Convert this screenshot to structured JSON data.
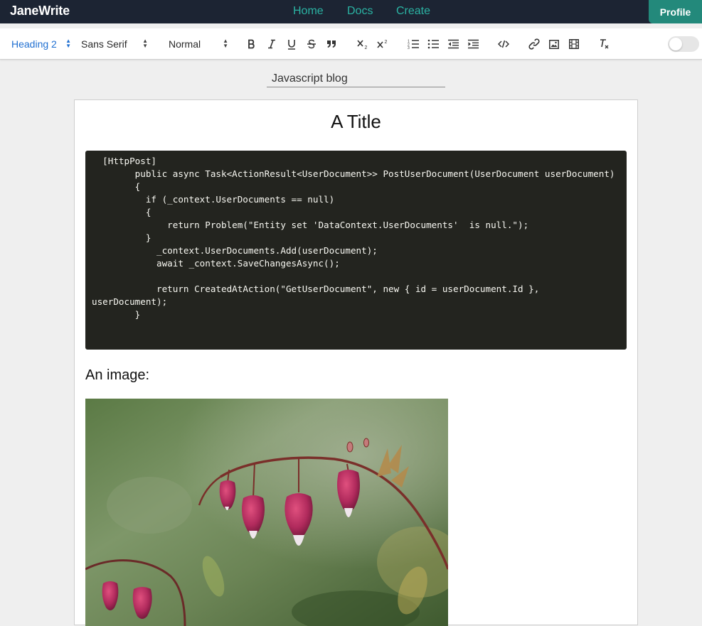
{
  "app": {
    "brand": "JaneWrite",
    "nav": [
      "Home",
      "Docs",
      "Create"
    ],
    "profile_label": "Profile"
  },
  "toolbar": {
    "header_select": "Heading 2",
    "font_select": "Sans Serif",
    "size_select": "Normal",
    "toggle_on": false
  },
  "document": {
    "blog_title": "Javascript blog",
    "heading": "A Title",
    "code": "  [HttpPost]\n        public async Task<ActionResult<UserDocument>> PostUserDocument(UserDocument userDocument)\n        {\n          if (_context.UserDocuments == null)\n          {\n              return Problem(\"Entity set 'DataContext.UserDocuments'  is null.\");\n          }\n            _context.UserDocuments.Add(userDocument);\n            await _context.SaveChangesAsync();\n\n            return CreatedAtAction(\"GetUserDocument\", new { id = userDocument.Id }, userDocument);\n        }",
    "image_caption": "An image:"
  },
  "colors": {
    "nav_bg": "#1c2433",
    "nav_link": "#2bb3a3",
    "profile_bg": "#23897b",
    "active_select": "#1f6fd1",
    "code_bg": "#23241f"
  }
}
